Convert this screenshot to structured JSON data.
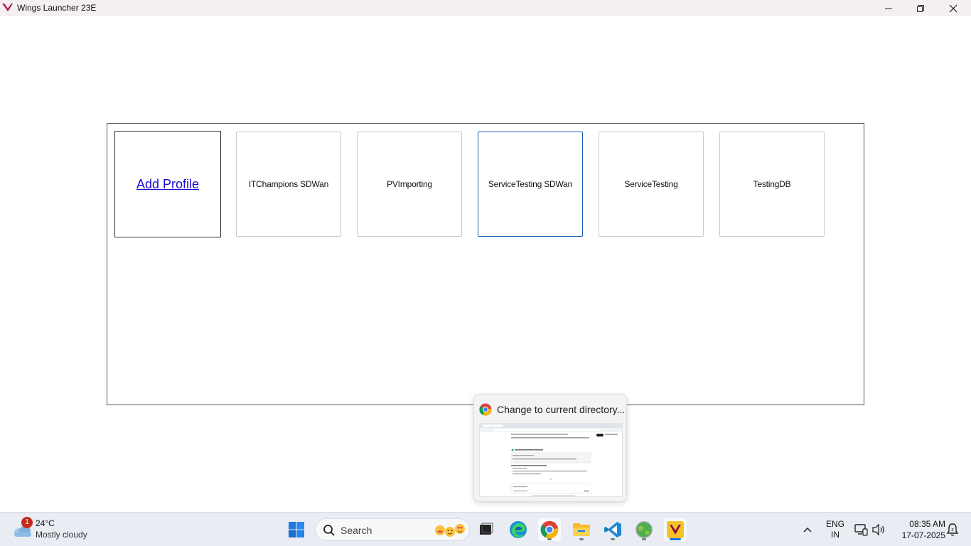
{
  "window": {
    "title": "Wings Launcher 23E"
  },
  "profiles": {
    "add_label": "Add Profile",
    "items": [
      {
        "label": "ITChampions SDWan"
      },
      {
        "label": "PVImporting"
      },
      {
        "label": "ServiceTesting SDWan",
        "selected": true
      },
      {
        "label": "ServiceTesting"
      },
      {
        "label": "TestingDB"
      }
    ]
  },
  "preview": {
    "title": "Change to current directory..."
  },
  "taskbar": {
    "weather": {
      "badge": "1",
      "temperature": "24°C",
      "condition": "Mostly cloudy"
    },
    "search_placeholder": "Search",
    "apps": [
      "start-icon",
      "task-view-icon",
      "edge-icon",
      "chrome-icon",
      "file-explorer-icon",
      "vscode-icon",
      "globe-app-icon",
      "wings-launcher-icon"
    ],
    "language": {
      "line1": "ENG",
      "line2": "IN"
    },
    "clock": {
      "time": "08:35 AM",
      "date": "17-07-2025"
    }
  },
  "colors": {
    "link": "#1a0dcc",
    "selected_border": "#1a5fb4",
    "titlebar_bg": "#f6efef",
    "taskbar_bg": "#e9edf3"
  }
}
